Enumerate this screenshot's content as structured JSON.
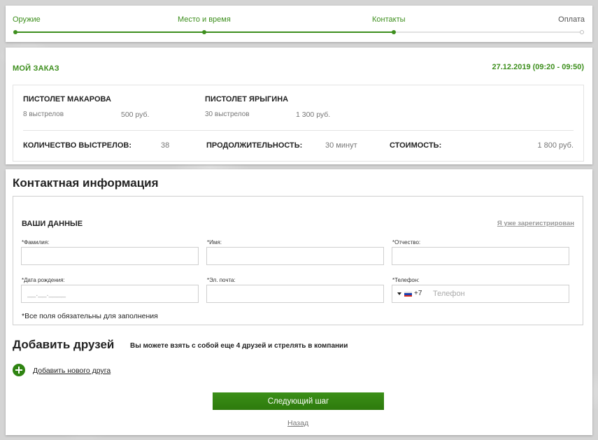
{
  "steps": [
    {
      "label": "Оружие",
      "active": true
    },
    {
      "label": "Место и время",
      "active": true
    },
    {
      "label": "Контакты",
      "active": true
    },
    {
      "label": "Оплата",
      "active": false
    }
  ],
  "order": {
    "title": "МОЙ ЗАКАЗ",
    "date": "27.12.2019 (09:20 - 09:50)",
    "items": [
      {
        "name": "ПИСТОЛЕТ МАКАРОВА",
        "shots": "8 выстрелов",
        "price": "500 руб."
      },
      {
        "name": "ПИСТОЛЕТ ЯРЫГИНА",
        "shots": "30 выстрелов",
        "price": "1 300 руб."
      }
    ],
    "summary": {
      "shots_label": "КОЛИЧЕСТВО ВЫСТРЕЛОВ:",
      "shots_value": "38",
      "duration_label": "ПРОДОЛЖИТЕЛЬНОСТЬ:",
      "duration_value": "30 минут",
      "cost_label": "СТОИМОСТЬ:",
      "cost_value": "1 800 руб."
    }
  },
  "contact": {
    "title": "Контактная информация",
    "form_title": "ВАШИ ДАННЫЕ",
    "login_link": "Я уже зарегистрирован",
    "fields": {
      "lastname": {
        "label": "*Фамилия:",
        "placeholder": ""
      },
      "firstname": {
        "label": "*Имя:",
        "placeholder": ""
      },
      "middlename": {
        "label": "*Отчество:",
        "placeholder": ""
      },
      "birthdate": {
        "label": "*Дата рождения:",
        "placeholder": "__.__.____"
      },
      "email": {
        "label": "*Эл. почта:",
        "placeholder": ""
      },
      "phone": {
        "label": "*Телефон:",
        "code": "+7",
        "placeholder": "Телефон"
      }
    },
    "required_note": "*Все поля обязательны для заполнения"
  },
  "friends": {
    "title": "Добавить друзей",
    "subtitle": "Вы можете взять с собой еще 4 друзей и стрелять в компании",
    "add_label": "Добавить нового друга"
  },
  "actions": {
    "next_label": "Следующий шаг",
    "back_label": "Назад"
  },
  "colors": {
    "accent": "#3e8f1e",
    "button": "#2f8412"
  }
}
